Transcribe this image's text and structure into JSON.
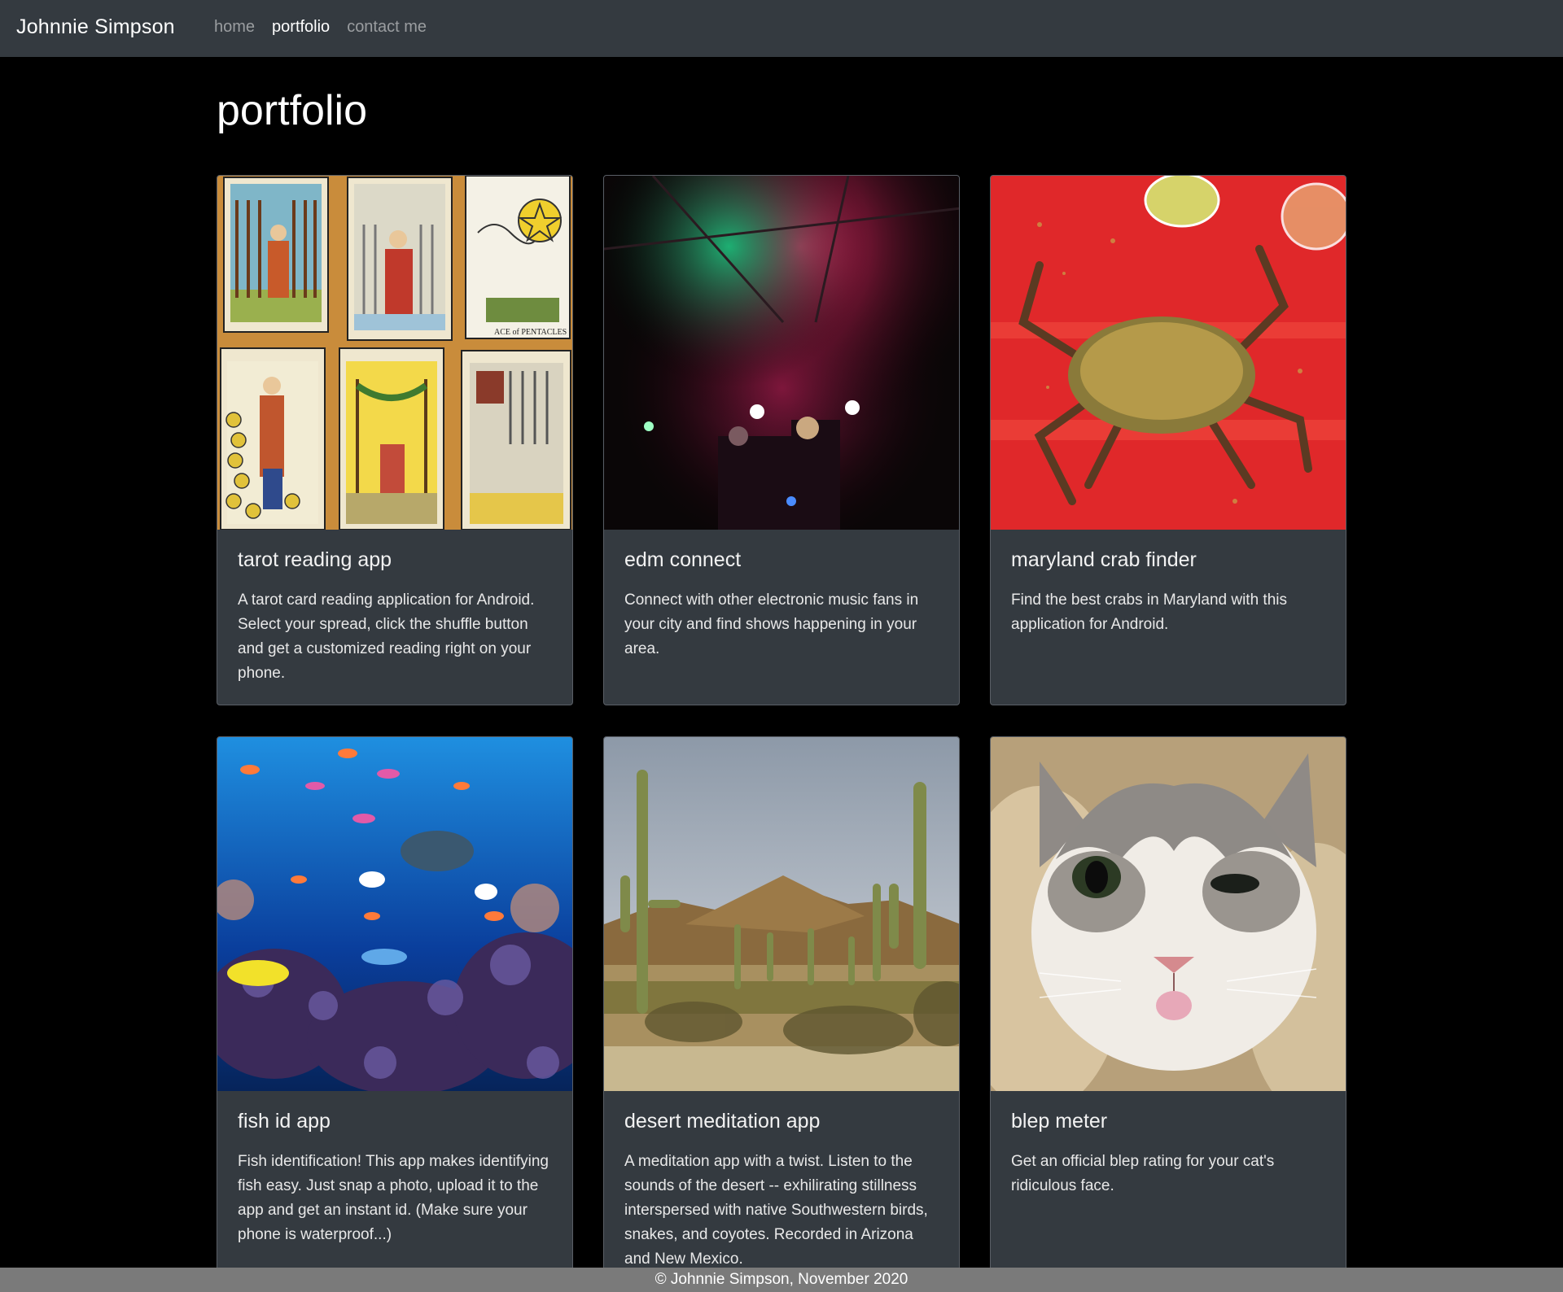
{
  "navbar": {
    "brand": "Johnnie Simpson",
    "links": [
      {
        "label": "home",
        "active": false
      },
      {
        "label": "portfolio",
        "active": true
      },
      {
        "label": "contact me",
        "active": false
      }
    ]
  },
  "page": {
    "title": "portfolio"
  },
  "cards": [
    {
      "title": "tarot reading app",
      "text": "A tarot card reading application for Android. Select your spread, click the shuffle button and get a customized reading right on your phone."
    },
    {
      "title": "edm connect",
      "text": "Connect with other electronic music fans in your city and find shows happening in your area."
    },
    {
      "title": "maryland crab finder",
      "text": "Find the best crabs in Maryland with this application for Android."
    },
    {
      "title": "fish id app",
      "text": "Fish identification! This app makes identifying fish easy. Just snap a photo, upload it to the app and get an instant id. (Make sure your phone is waterproof...)"
    },
    {
      "title": "desert meditation app",
      "text": "A meditation app with a twist. Listen to the sounds of the desert -- exhilirating stillness interspersed with native Southwestern birds, snakes, and coyotes. Recorded in Arizona and New Mexico."
    },
    {
      "title": "blep meter",
      "text": "Get an official blep rating for your cat's ridiculous face."
    }
  ],
  "footer": {
    "text": "© Johnnie Simpson, November 2020"
  },
  "colors": {
    "navbar": "#343a40",
    "card": "#343a40",
    "footer": "#7a7a7a",
    "background": "#000000"
  }
}
